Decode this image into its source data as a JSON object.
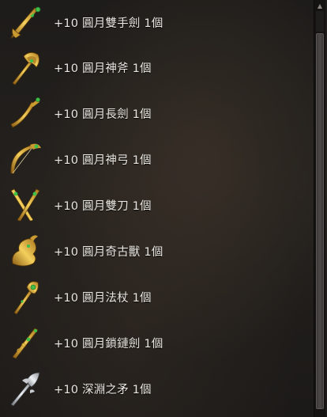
{
  "items": [
    {
      "label": "+10 圓月雙手劍 1個",
      "icon": "two-handed-sword-icon"
    },
    {
      "label": "+10 圓月神斧 1個",
      "icon": "axe-icon"
    },
    {
      "label": "+10 圓月長劍 1個",
      "icon": "long-sword-icon"
    },
    {
      "label": "+10 圓月神弓 1個",
      "icon": "bow-icon"
    },
    {
      "label": "+10 圓月雙刀 1個",
      "icon": "dual-blades-icon"
    },
    {
      "label": "+10 圓月奇古獸 1個",
      "icon": "kiringku-icon"
    },
    {
      "label": "+10 圓月法杖 1個",
      "icon": "staff-icon"
    },
    {
      "label": "+10 圓月鎖鏈劍 1個",
      "icon": "chain-sword-icon"
    },
    {
      "label": "+10 深淵之矛 1個",
      "icon": "spear-icon"
    }
  ],
  "colors": {
    "text": "#e9e6e1",
    "gold": "#d4a73a",
    "gem": "#3fbf4a",
    "silver": "#c9cdd2"
  }
}
